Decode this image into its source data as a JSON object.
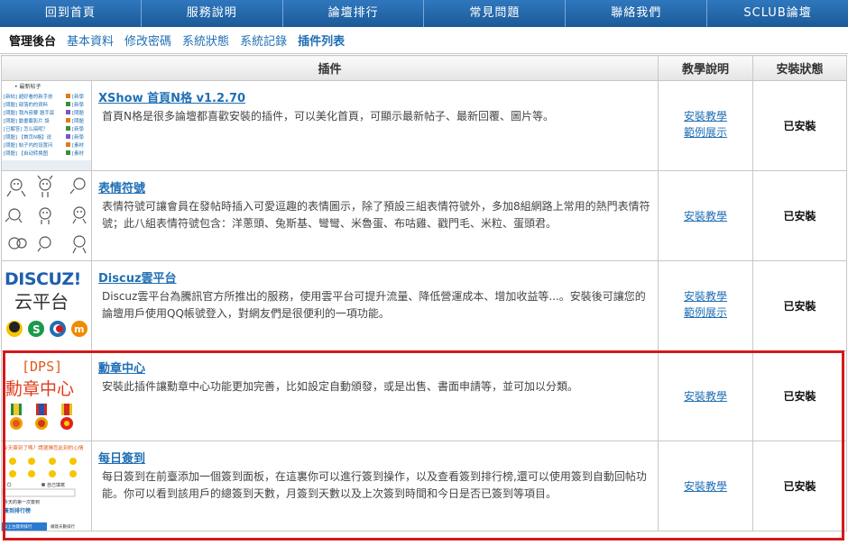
{
  "top_nav": [
    {
      "label": "回到首頁"
    },
    {
      "label": "服務說明"
    },
    {
      "label": "論壇排行"
    },
    {
      "label": "常見問題"
    },
    {
      "label": "聯絡我們"
    },
    {
      "label": "SCLUB論壇"
    }
  ],
  "sub_nav": {
    "title": "管理後台",
    "items": [
      {
        "label": "基本資料"
      },
      {
        "label": "修改密碼"
      },
      {
        "label": "系統狀態"
      },
      {
        "label": "系統記錄"
      },
      {
        "label": "插件列表"
      }
    ]
  },
  "table": {
    "headers": {
      "plugin": "插件",
      "help": "教學說明",
      "status": "安裝狀態"
    },
    "rows": [
      {
        "name": "XShow 首頁N格 v1.2.70",
        "desc": "首頁N格是很多論壇都喜歡安裝的插件，可以美化首頁，可顯示最新帖子、最新回覆、圖片等。",
        "links": [
          "安裝教學",
          "範例展示"
        ],
        "status": "已安裝",
        "thumb": {
          "header": "• 最新帖子",
          "lines": [
            "[新帖] 超好看的新手技",
            "[問題] 部落的的資料",
            "[問題] 我內容要 題手頁",
            "[問題] 動畫載影片 設",
            "[已解答] 怎么搞呢？",
            "[問題] 【首页N格】说",
            "[問題] 帖子内的设置问",
            "[問題] 【自动转换图"
          ],
          "tags": [
            "[新學",
            "[新學",
            "[問題",
            "[問題",
            "[新學",
            "[新學",
            "[素材",
            "[素材"
          ]
        }
      },
      {
        "name": "表情符號",
        "desc": "表情符號可讓會員在發帖時插入可愛逗趣的表情圖示，除了預設三組表情符號外，多加8組網路上常用的熱門表情符號；此八組表情符號包含：洋蔥頭、兔斯基、彎彎、米魯蛋、布咕雞、戳門毛、米粒、蛋頭君。",
        "links": [
          "安裝教學"
        ],
        "status": "已安裝"
      },
      {
        "name": "Discuz雲平台",
        "desc": "Discuz雲平台為騰訊官方所推出的服務，使用雲平台可提升流量、降低營運成本、增加收益等...。安裝後可讓您的論壇用戶使用QQ帳號登入，對網友們是很便利的一項功能。",
        "links": [
          "安裝教學",
          "範例展示"
        ],
        "status": "已安裝",
        "thumb": {
          "logo": "DISCUZ!",
          "sub": "云平台"
        }
      },
      {
        "name": "勳章中心",
        "desc": "安裝此插件讓勳章中心功能更加完善，比如設定自動頒發，或是出售、書面申請等，並可加以分類。",
        "links": [
          "安裝教學"
        ],
        "status": "已安裝",
        "thumb": {
          "title": "[DPS]",
          "sub": "勳章中心"
        }
      },
      {
        "name": "每日簽到",
        "desc": "每日簽到在前臺添加一個簽到面板，在這裏你可以進行簽到操作，以及查看簽到排行榜,還可以使用簽到自動回帖功能。你可以看到該用戶的總簽到天數，月簽到天數以及上次簽到時間和今日是否已簽到等項目。",
        "links": [
          "安裝教學"
        ],
        "status": "已安裝",
        "thumb": {
          "banner": "今天簽到了嗎？請選擇您此刻的心情",
          "line1": "自己填寫",
          "line2": "今天的第一次簽到",
          "rank": "簽到排行榜",
          "btn1": "以上台簽到排行",
          "btn2": "總簽天數排行"
        }
      }
    ]
  },
  "colors": {
    "nav": "#1e5e9c",
    "link": "#1f6fb4",
    "highlight": "#d4191c"
  }
}
